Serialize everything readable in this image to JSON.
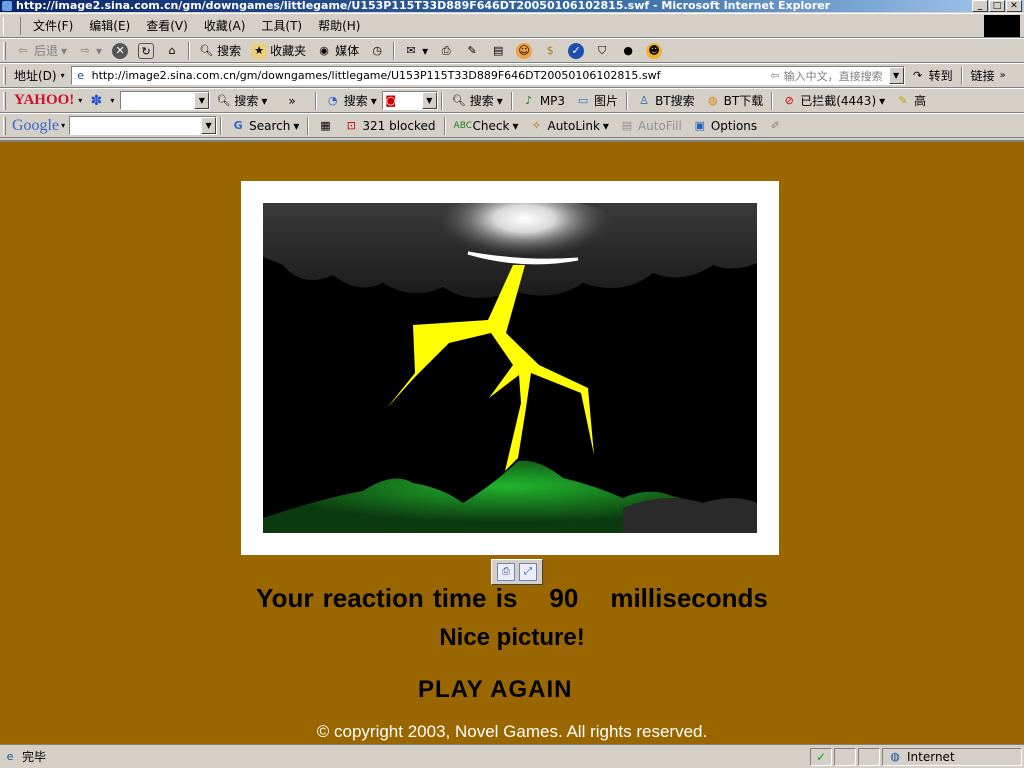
{
  "window": {
    "title": "http://image2.sina.com.cn/gm/downgames/littlegame/U153P115T33D889F646DT20050106102815.swf - Microsoft Internet Explorer",
    "min": "_",
    "max": "□",
    "close": "✕"
  },
  "menu": [
    "文件(F)",
    "编辑(E)",
    "查看(V)",
    "收藏(A)",
    "工具(T)",
    "帮助(H)"
  ],
  "toolbar": {
    "back": "后退",
    "search": "搜索",
    "favorites": "收藏夹",
    "media": "媒体"
  },
  "address": {
    "label": "地址(D)",
    "url": "http://image2.sina.com.cn/gm/downgames/littlegame/U153P115T33D889F646DT20050106102815.swf",
    "hint": "输入中文，直接搜索",
    "go": "转到",
    "links": "链接"
  },
  "yahoo_bar": {
    "logo": "YAHOO!",
    "search": "搜索",
    "search2": "搜索",
    "search3": "搜索",
    "mp3": "MP3",
    "images": "图片",
    "bt_search": "BT搜索",
    "bt_download": "BT下载",
    "blocked": "已拦截(4443)",
    "high": "高"
  },
  "google_bar": {
    "logo": "Google",
    "search": "Search",
    "blocked": "321 blocked",
    "check": "Check",
    "autolink": "AutoLink",
    "autofill": "AutoFill",
    "options": "Options"
  },
  "game": {
    "reaction_prefix": "Your reaction time is",
    "reaction_value": "90",
    "reaction_unit": "milliseconds",
    "message": "Nice picture!",
    "play_again": "PLAY AGAIN",
    "copyright": "© copyright 2003, Novel Games. All rights reserved."
  },
  "status": {
    "text": "完毕",
    "zone": "Internet"
  },
  "colors": {
    "page_background": "#996600",
    "lightning": "#ffff00",
    "hill": "#1d9a2a"
  }
}
